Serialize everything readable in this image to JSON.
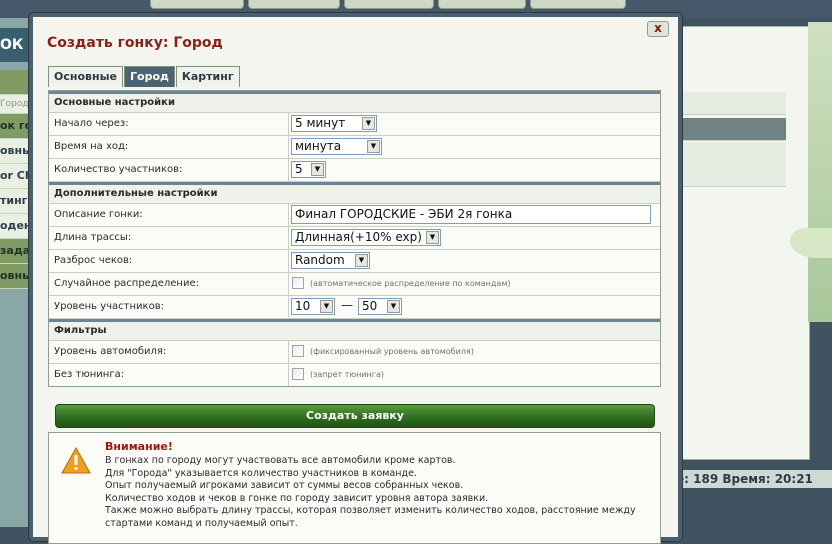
{
  "background": {
    "left_header": "ОК",
    "left_items": [
      {
        "text": "",
        "style": "dark"
      },
      {
        "text": "Город 25",
        "style": "sub"
      },
      {
        "text": "ок город",
        "style": "dark"
      },
      {
        "text": "овные",
        "style": ""
      },
      {
        "text": "or Ch",
        "style": ""
      },
      {
        "text": "тинг",
        "style": ""
      },
      {
        "text": "оден",
        "style": ""
      },
      {
        "text": "задать",
        "style": "dark"
      },
      {
        "text": "овные",
        "style": "dark"
      }
    ],
    "status_bar": "е: 189  Время: 20:21"
  },
  "dialog": {
    "title": "Создать гонку: Город",
    "close_label": "x",
    "tabs": [
      {
        "label": "Основные",
        "active": false
      },
      {
        "label": "Город",
        "active": true
      },
      {
        "label": "Картинг",
        "active": false
      }
    ],
    "sections": {
      "basic": {
        "title": "Основные настройки",
        "start_in": {
          "label": "Начало через:",
          "value": "5 минут"
        },
        "turn_time": {
          "label": "Время на ход:",
          "value": "минута"
        },
        "participants": {
          "label": "Количество участников:",
          "value": "5"
        }
      },
      "extra": {
        "title": "Дополнительные настройки",
        "description": {
          "label": "Описание гонки:",
          "value": "Финал  ГОРОДСКИЕ - ЭБИ  2я гонка"
        },
        "track_length": {
          "label": "Длина трассы:",
          "value": "Длинная(+10% exp)"
        },
        "checks_spread": {
          "label": "Разброс чеков:",
          "value": "Random"
        },
        "random_distribution": {
          "label": "Случайное распределение:",
          "checked": false,
          "hint": "(автоматическое распределение по командам)"
        },
        "level": {
          "label": "Уровень участников:",
          "min": "10",
          "separator": "—",
          "max": "50"
        }
      },
      "filters": {
        "title": "Фильтры",
        "car_level": {
          "label": "Уровень автомобиля:",
          "checked": false,
          "hint": "(фиксированный уровень автомобиля)"
        },
        "no_tuning": {
          "label": "Без тюнинга:",
          "checked": false,
          "hint": "(запрет тюнинга)"
        }
      }
    },
    "submit_label": "Создать заявку",
    "notice": {
      "title": "Внимание!",
      "lines": [
        "В гонках по городу могут участвовать все автомобили кроме картов.",
        "Для \"Города\" указывается количество участников в команде.",
        "Опыт получаемый игроками зависит от суммы весов собранных чеков.",
        "Количество ходов и чеков в гонке по городу зависит уровня автора заявки.",
        "Также можно выбрать длину трассы, которая позволяет изменить количество ходов, расстояние между",
        "стартами команд и получаемый опыт."
      ]
    }
  },
  "colors": {
    "title_red": "#8b1e15",
    "tab_active": "#4a6473",
    "submit_green": "#2f6f1f",
    "warning_orange": "#f0a020"
  }
}
